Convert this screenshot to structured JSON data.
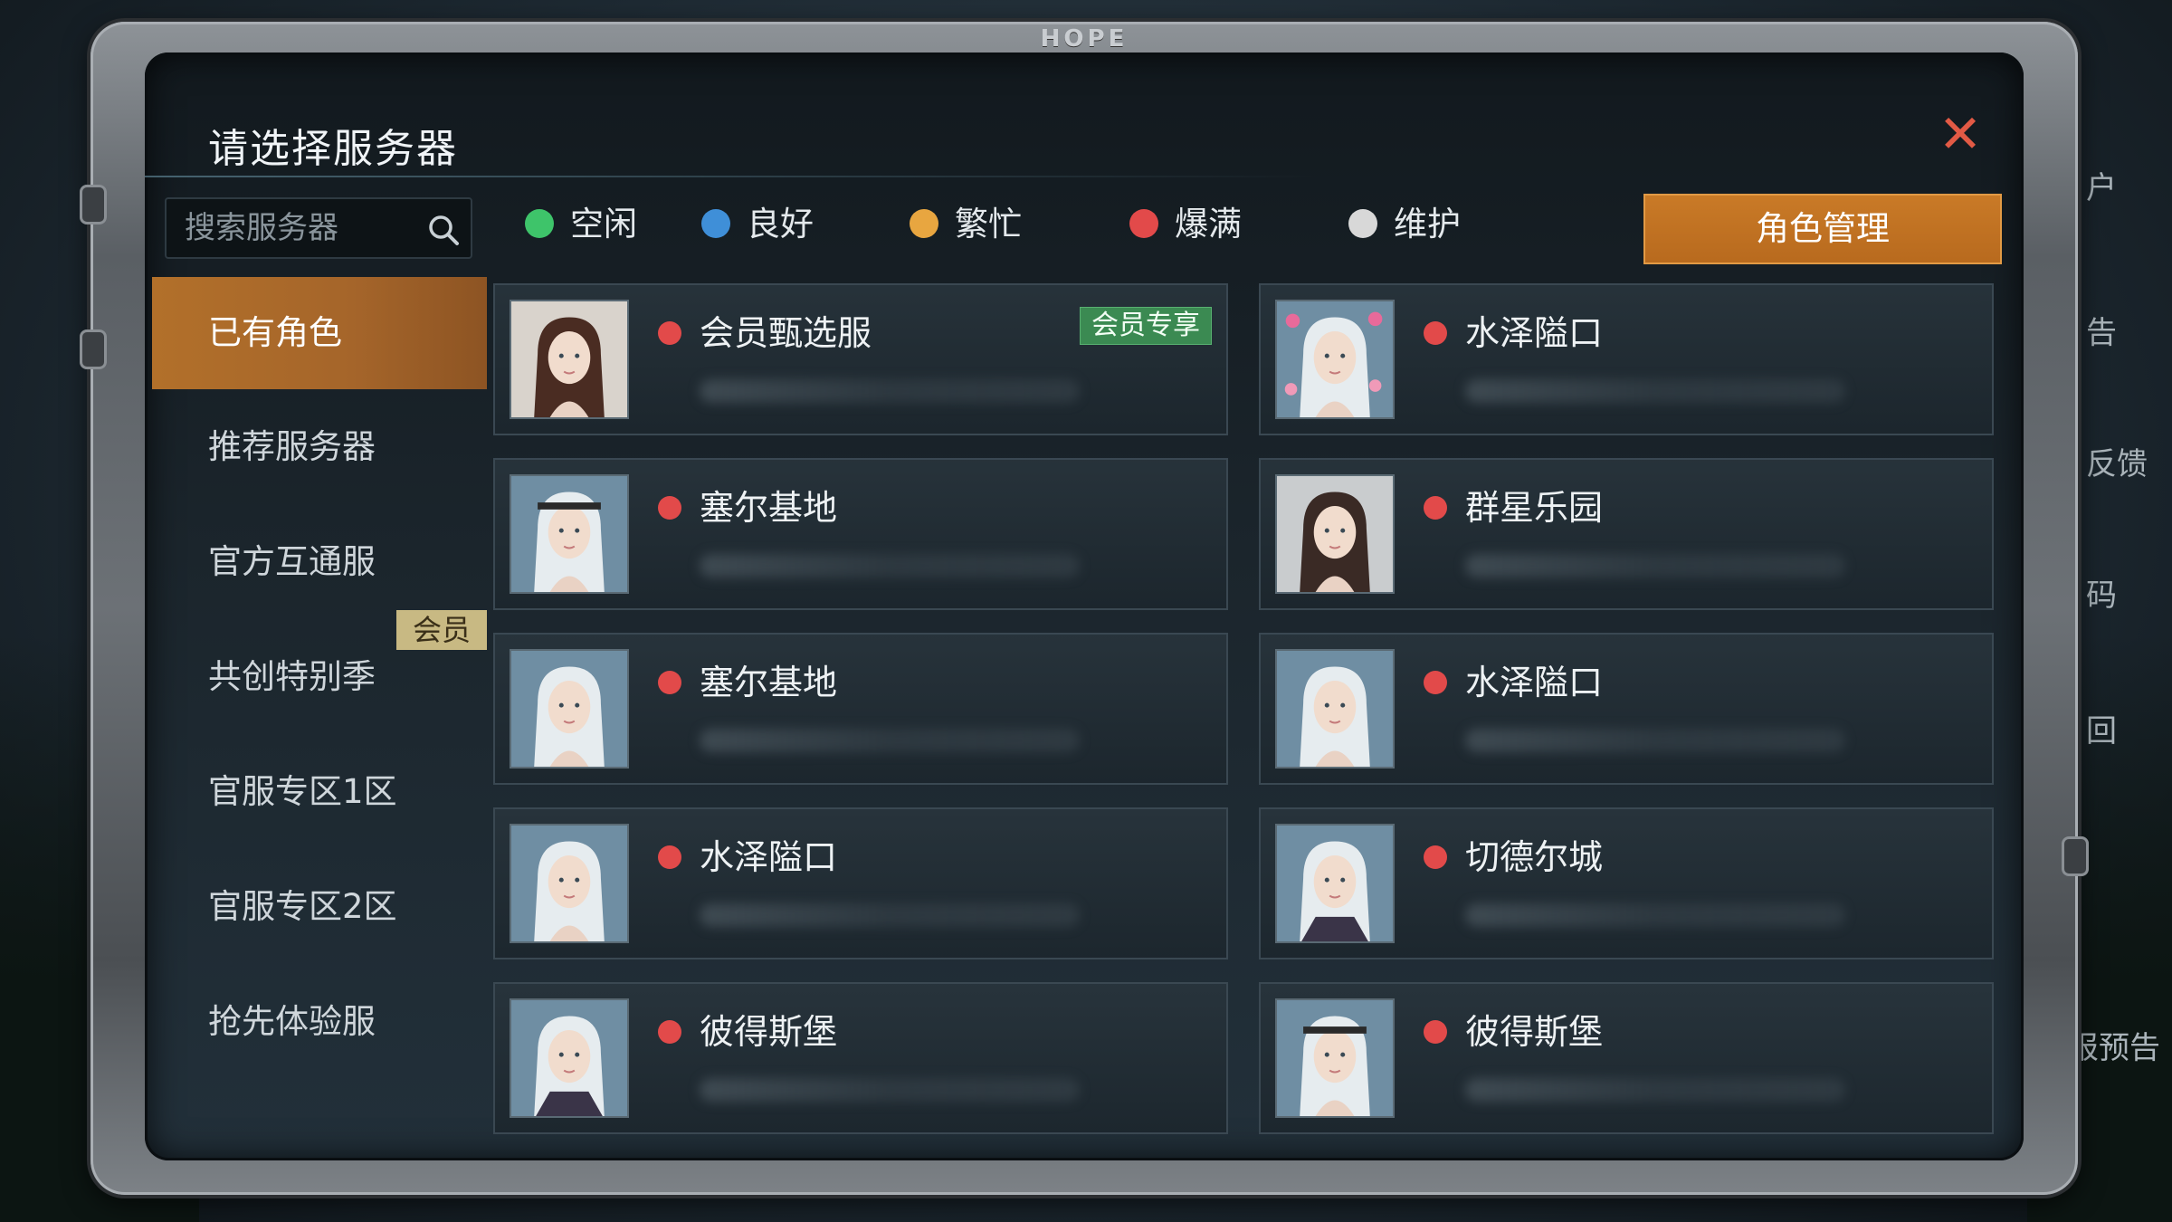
{
  "frame": {
    "logo": "HOPE"
  },
  "dialog": {
    "title": "请选择服务器",
    "close_icon": "close-icon"
  },
  "search": {
    "placeholder": "搜索服务器",
    "value": ""
  },
  "sidebar": {
    "items": [
      {
        "label": "已有角色",
        "active": true
      },
      {
        "label": "推荐服务器",
        "active": false
      },
      {
        "label": "官方互通服",
        "active": false
      },
      {
        "label": "共创特别季",
        "active": false,
        "tag": "会员"
      },
      {
        "label": "官服专区1区",
        "active": false
      },
      {
        "label": "官服专区2区",
        "active": false
      },
      {
        "label": "抢先体验服",
        "active": false
      }
    ]
  },
  "legend": [
    {
      "label": "空闲",
      "color": "#3ec46a"
    },
    {
      "label": "良好",
      "color": "#3f8fd8"
    },
    {
      "label": "繁忙",
      "color": "#e8a640"
    },
    {
      "label": "爆满",
      "color": "#e24a4a"
    },
    {
      "label": "维护",
      "color": "#d8d8d8"
    }
  ],
  "role_manage_label": "角色管理",
  "servers": [
    {
      "name": "会员甄选服",
      "status": "爆满",
      "badge": "会员专享",
      "avatar": "female-brown-hair"
    },
    {
      "name": "水泽隘口",
      "status": "爆满",
      "avatar": "girl-silver-hair-hearts"
    },
    {
      "name": "塞尔基地",
      "status": "爆满",
      "avatar": "white-hair-headband"
    },
    {
      "name": "群星乐园",
      "status": "爆满",
      "avatar": "female-dark-hair"
    },
    {
      "name": "塞尔基地",
      "status": "爆满",
      "avatar": "white-hair"
    },
    {
      "name": "水泽隘口",
      "status": "爆满",
      "avatar": "white-hair"
    },
    {
      "name": "水泽隘口",
      "status": "爆满",
      "avatar": "white-hair"
    },
    {
      "name": "切德尔城",
      "status": "爆满",
      "avatar": "white-hair-armor"
    },
    {
      "name": "彼得斯堡",
      "status": "爆满",
      "avatar": "white-hair-armor"
    },
    {
      "name": "彼得斯堡",
      "status": "爆满",
      "avatar": "white-hair-headband"
    }
  ],
  "right_edge": [
    "户",
    "告",
    "反馈",
    "码",
    "回",
    "报预告"
  ]
}
